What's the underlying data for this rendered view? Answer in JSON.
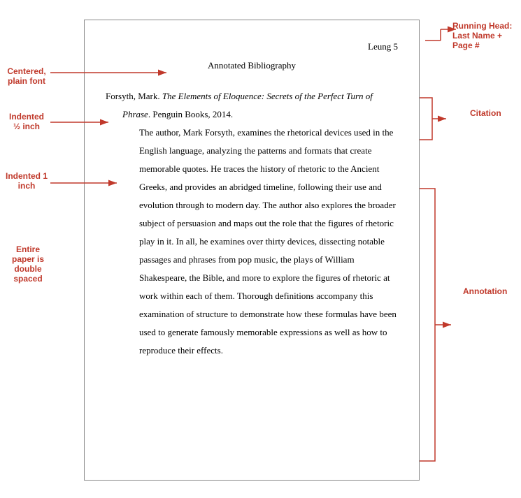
{
  "paper": {
    "header": {
      "right_text": "Leung 5"
    },
    "title": "Annotated Bibliography",
    "citation": {
      "text": "Forsyth, Mark. The Elements of Eloquence: Secrets of the Perfect Turn of Phrase. Penguin Books, 2014.",
      "italic_part": "The Elements of Eloquence: Secrets of the Perfect Turn of Phrase"
    },
    "annotation": "The author, Mark Forsyth, examines the rhetorical devices used in the English language, analyzing the patterns and formats that create memorable quotes. He traces the history of rhetoric to the Ancient Greeks, and provides an abridged timeline, following their use and evolution through to modern day. The author also explores the broader subject of persuasion and maps out the role that the figures of rhetoric play in it. In all, he examines over thirty devices, dissecting notable passages and phrases from pop music, the plays of William Shakespeare, the Bible, and more to explore the figures of rhetoric at work within each of them. Thorough definitions accompany this examination of structure to demonstrate how these formulas have been used to generate famously memorable expressions as well as how to reproduce their effects."
  },
  "labels": {
    "centered": "Centered, plain font",
    "half_inch": "Indented ½ inch",
    "one_inch": "Indented 1 inch",
    "double_spaced": "Entire paper is double spaced",
    "running_head": "Running Head: Last Name + Page #",
    "citation": "Citation",
    "annotation": "Annotation"
  }
}
